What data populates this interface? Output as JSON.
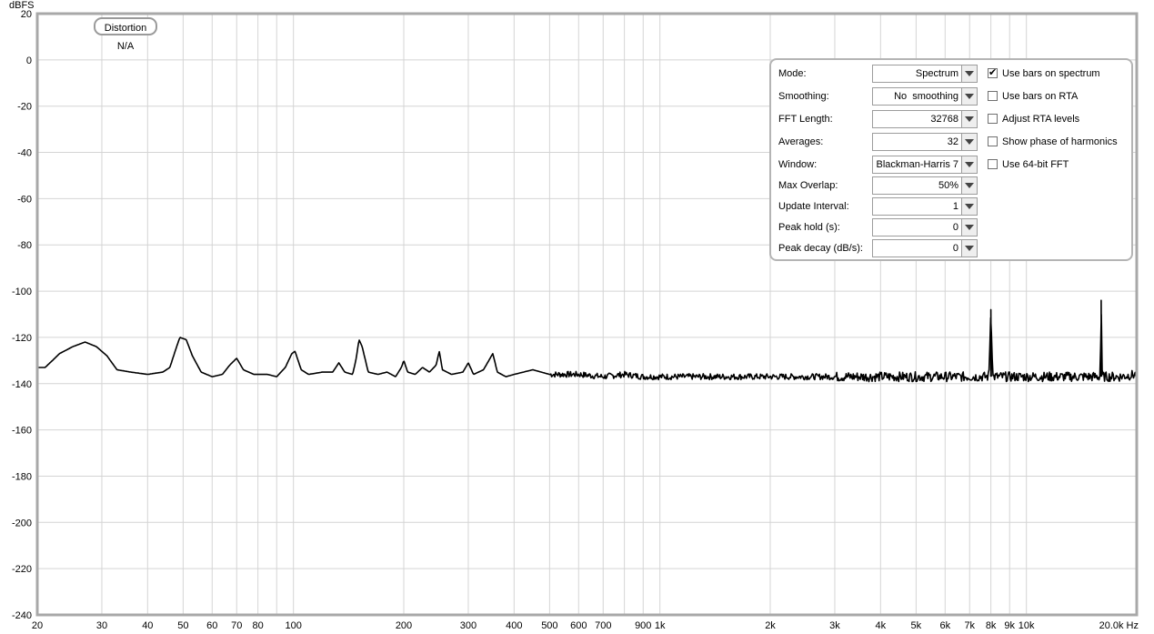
{
  "chart_data": {
    "type": "line",
    "ylabel": "dBFS",
    "x_unit_label": "20.0k Hz",
    "x_scale": "log",
    "xlim": [
      20,
      20000
    ],
    "ylim": [
      -240,
      20
    ],
    "grid": true,
    "y_ticks": [
      20,
      0,
      -20,
      -40,
      -60,
      -80,
      -100,
      -120,
      -140,
      -160,
      -180,
      -200,
      -220,
      -240
    ],
    "x_ticks": [
      {
        "v": 20,
        "label": "20"
      },
      {
        "v": 30,
        "label": "30"
      },
      {
        "v": 40,
        "label": "40"
      },
      {
        "v": 50,
        "label": "50"
      },
      {
        "v": 60,
        "label": "60"
      },
      {
        "v": 70,
        "label": "70"
      },
      {
        "v": 80,
        "label": "80"
      },
      {
        "v": 100,
        "label": "100"
      },
      {
        "v": 200,
        "label": "200"
      },
      {
        "v": 300,
        "label": "300"
      },
      {
        "v": 400,
        "label": "400"
      },
      {
        "v": 500,
        "label": "500"
      },
      {
        "v": 600,
        "label": "600"
      },
      {
        "v": 700,
        "label": "700"
      },
      {
        "v": 900,
        "label": "900"
      },
      {
        "v": 1000,
        "label": "1k"
      },
      {
        "v": 2000,
        "label": "2k"
      },
      {
        "v": 3000,
        "label": "3k"
      },
      {
        "v": 4000,
        "label": "4k"
      },
      {
        "v": 5000,
        "label": "5k"
      },
      {
        "v": 6000,
        "label": "6k"
      },
      {
        "v": 7000,
        "label": "7k"
      },
      {
        "v": 8000,
        "label": "8k"
      },
      {
        "v": 9000,
        "label": "9k"
      },
      {
        "v": 10000,
        "label": "10k"
      }
    ],
    "grid_x": [
      20,
      30,
      40,
      50,
      60,
      70,
      80,
      90,
      100,
      200,
      300,
      400,
      500,
      600,
      700,
      800,
      900,
      1000,
      2000,
      3000,
      4000,
      5000,
      6000,
      7000,
      8000,
      9000,
      10000,
      20000
    ],
    "series": [
      {
        "color": "#000000",
        "noise_floor": -137,
        "points": [
          [
            20,
            -133
          ],
          [
            21,
            -133
          ],
          [
            22,
            -130
          ],
          [
            23,
            -127
          ],
          [
            25,
            -124
          ],
          [
            27,
            -122
          ],
          [
            29,
            -124
          ],
          [
            31,
            -128
          ],
          [
            33,
            -134
          ],
          [
            36,
            -135
          ],
          [
            40,
            -136
          ],
          [
            44,
            -135
          ],
          [
            46,
            -133
          ],
          [
            48,
            -124
          ],
          [
            49,
            -120
          ],
          [
            51,
            -121
          ],
          [
            53,
            -128
          ],
          [
            56,
            -135
          ],
          [
            60,
            -137
          ],
          [
            64,
            -136
          ],
          [
            67,
            -132
          ],
          [
            70,
            -129
          ],
          [
            73,
            -134
          ],
          [
            78,
            -136
          ],
          [
            85,
            -136
          ],
          [
            90,
            -137
          ],
          [
            95,
            -133
          ],
          [
            99,
            -127
          ],
          [
            101,
            -126
          ],
          [
            105,
            -134
          ],
          [
            110,
            -136
          ],
          [
            120,
            -135
          ],
          [
            128,
            -135
          ],
          [
            133,
            -131
          ],
          [
            138,
            -135
          ],
          [
            145,
            -136
          ],
          [
            148,
            -130
          ],
          [
            151,
            -121
          ],
          [
            154,
            -124
          ],
          [
            160,
            -135
          ],
          [
            170,
            -136
          ],
          [
            180,
            -135
          ],
          [
            190,
            -137
          ],
          [
            197,
            -133
          ],
          [
            200,
            -130
          ],
          [
            205,
            -135
          ],
          [
            215,
            -136
          ],
          [
            225,
            -133
          ],
          [
            235,
            -135
          ],
          [
            245,
            -132
          ],
          [
            250,
            -126
          ],
          [
            255,
            -134
          ],
          [
            270,
            -136
          ],
          [
            290,
            -135
          ],
          [
            300,
            -131
          ],
          [
            310,
            -136
          ],
          [
            330,
            -134
          ],
          [
            350,
            -127
          ],
          [
            360,
            -135
          ],
          [
            380,
            -137
          ],
          [
            400,
            -136
          ],
          [
            450,
            -134
          ],
          [
            500,
            -136
          ],
          [
            600,
            -136
          ],
          [
            700,
            -137
          ],
          [
            800,
            -136
          ],
          [
            900,
            -137
          ],
          [
            1000,
            -137
          ],
          [
            1500,
            -137
          ],
          [
            2000,
            -137
          ],
          [
            3000,
            -137
          ],
          [
            4000,
            -137
          ],
          [
            5000,
            -137
          ],
          [
            6000,
            -137
          ],
          [
            7000,
            -137
          ],
          [
            7900,
            -137
          ],
          [
            8000,
            -108
          ],
          [
            8100,
            -137
          ],
          [
            9000,
            -137
          ],
          [
            10000,
            -137
          ],
          [
            13000,
            -137
          ],
          [
            15900,
            -137
          ],
          [
            16000,
            -104
          ],
          [
            16100,
            -137
          ],
          [
            18000,
            -137
          ],
          [
            20000,
            -136
          ]
        ]
      }
    ]
  },
  "badge": {
    "label": "Distortion N/A"
  },
  "controls": {
    "rows": [
      {
        "label": "Mode:",
        "value": "Spectrum"
      },
      {
        "label": "Smoothing:",
        "value": "No  smoothing"
      },
      {
        "label": "FFT Length:",
        "value": "32768"
      },
      {
        "label": "Averages:",
        "value": "32"
      },
      {
        "label": "Window:",
        "value": "Blackman-Harris 7"
      },
      {
        "label": "Max Overlap:",
        "value": "50%"
      },
      {
        "label": "Update Interval:",
        "value": "1"
      },
      {
        "label": "Peak hold (s):",
        "value": "0"
      },
      {
        "label": "Peak decay (dB/s):",
        "value": "0"
      }
    ],
    "checks": [
      {
        "label": "Use bars on spectrum",
        "checked": true
      },
      {
        "label": "Use bars on RTA",
        "checked": false
      },
      {
        "label": "Adjust RTA levels",
        "checked": false
      },
      {
        "label": "Show phase of harmonics",
        "checked": false
      },
      {
        "label": "Use 64-bit FFT",
        "checked": false
      }
    ]
  }
}
